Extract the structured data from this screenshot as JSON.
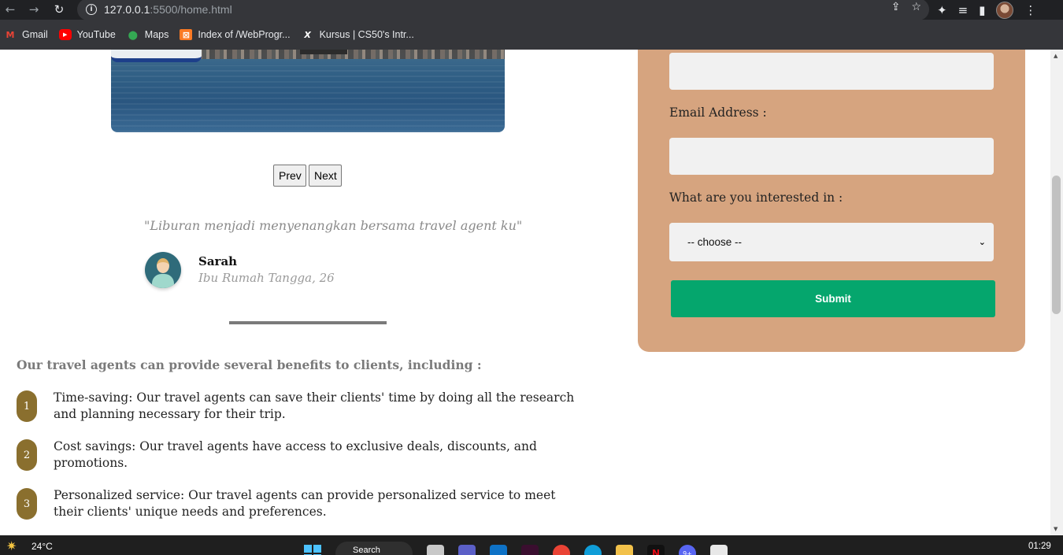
{
  "browser": {
    "url_host": "127.0.0.1",
    "url_rest": ":5500/home.html",
    "bookmarks": [
      {
        "label": "Gmail",
        "icon": "gmail-icon"
      },
      {
        "label": "YouTube",
        "icon": "youtube-icon"
      },
      {
        "label": "Maps",
        "icon": "maps-icon"
      },
      {
        "label": "Index of /WebProgr...",
        "icon": "xampp-icon"
      },
      {
        "label": "Kursus | CS50's Intr...",
        "icon": "x-icon"
      }
    ]
  },
  "slider": {
    "prev_label": "Prev",
    "next_label": "Next"
  },
  "testimonial": {
    "quote": "\"Liburan menjadi menyenangkan bersama travel agent ku\"",
    "name": "Sarah",
    "role": "Ibu Rumah Tangga, 26"
  },
  "benefits": {
    "title": "Our travel agents can provide several benefits to clients, including :",
    "items": [
      {
        "number": "1",
        "text": "Time-saving: Our travel agents can save their clients' time by doing all the research and planning necessary for their trip."
      },
      {
        "number": "2",
        "text": "Cost savings: Our travel agents have access to exclusive deals, discounts, and promotions."
      },
      {
        "number": "3",
        "text": "Personalized service: Our travel agents can provide personalized service to meet their clients' unique needs and preferences."
      }
    ]
  },
  "form": {
    "email_label": "Email Address :",
    "interest_label": "What are you interested in :",
    "select_value": "-- choose --",
    "submit_label": "Submit"
  },
  "taskbar": {
    "temperature": "24°C",
    "search_label": "Search",
    "time": "01:29",
    "notification_badge": "9+"
  },
  "colors": {
    "form_bg": "#d6a47f",
    "submit_bg": "#05a66d",
    "badge_bg": "#8a6f2e"
  }
}
